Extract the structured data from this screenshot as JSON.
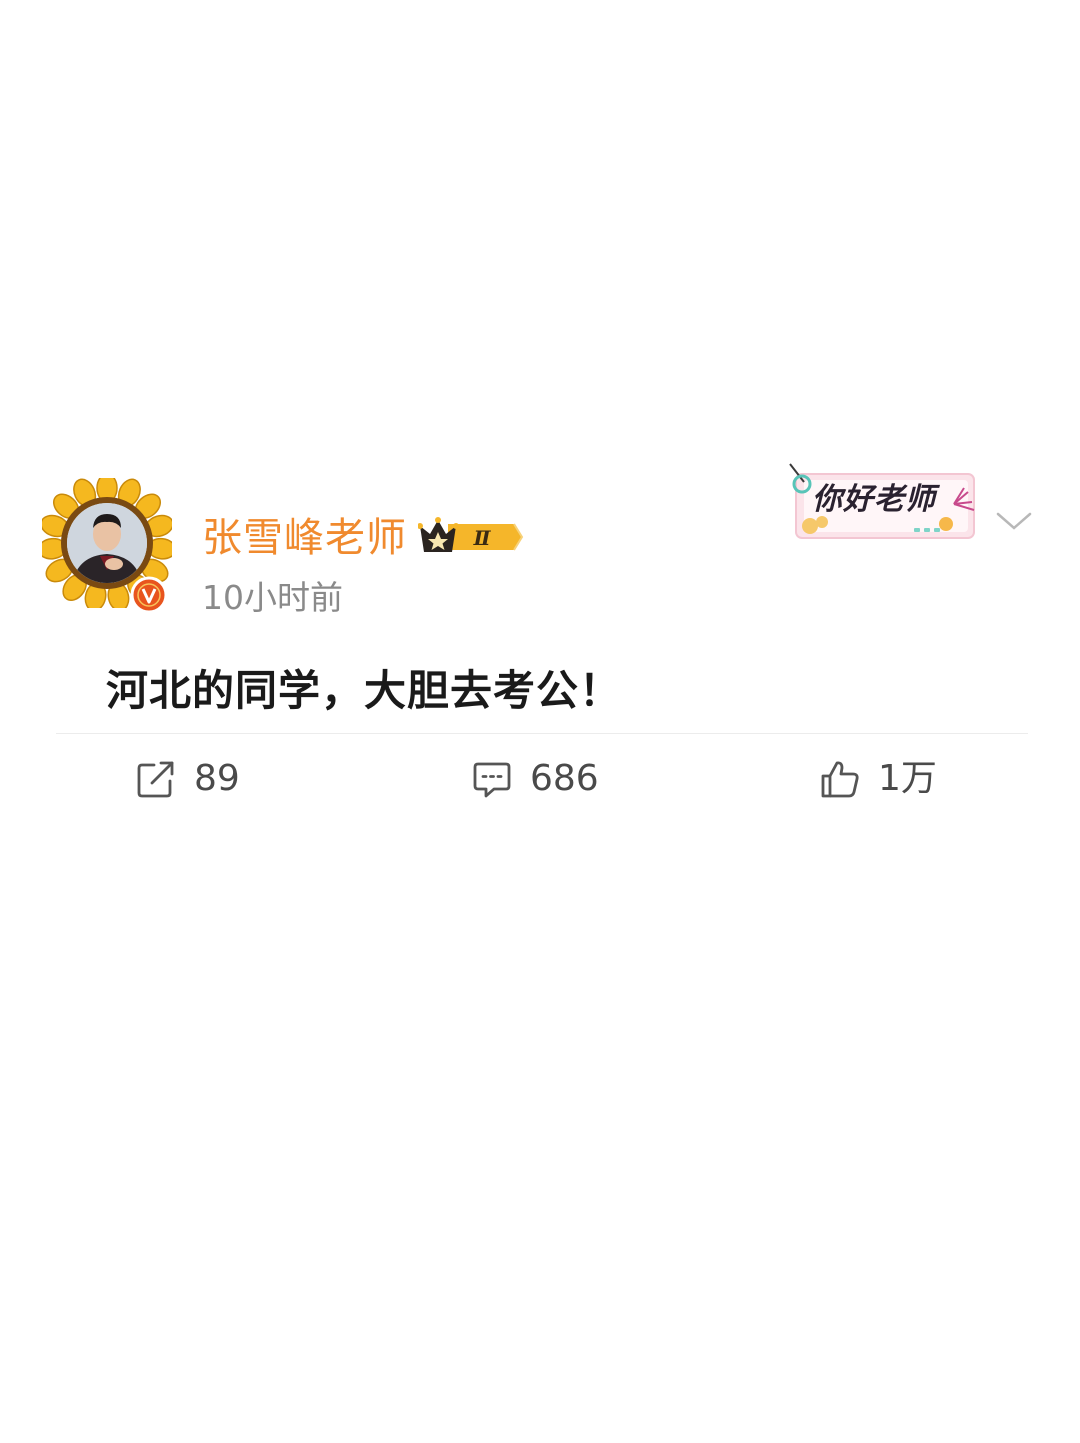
{
  "post": {
    "author": {
      "name": "张雪峰老师",
      "vip_level": "Ⅱ"
    },
    "time": "10小时前",
    "decor_card_text": "你好老师",
    "content": "河北的同学，大胆去考公！",
    "actions": {
      "repost_count": "89",
      "comment_count": "686",
      "like_count": "1万"
    }
  },
  "colors": {
    "name_color": "#f08a2e",
    "verified_color": "#e8541e",
    "crown_gold": "#f5b62a",
    "text_secondary": "#8a8a8a",
    "text_primary": "#1a1a1a",
    "icon_gray": "#555555"
  },
  "icons": {
    "avatar_frame": "sunflower-frame-icon",
    "verified": "verified-v-icon",
    "vip": "crown-icon",
    "more": "chevron-down-icon",
    "repost": "share-arrow-icon",
    "comment": "comment-bubble-icon",
    "like": "thumbs-up-icon"
  }
}
